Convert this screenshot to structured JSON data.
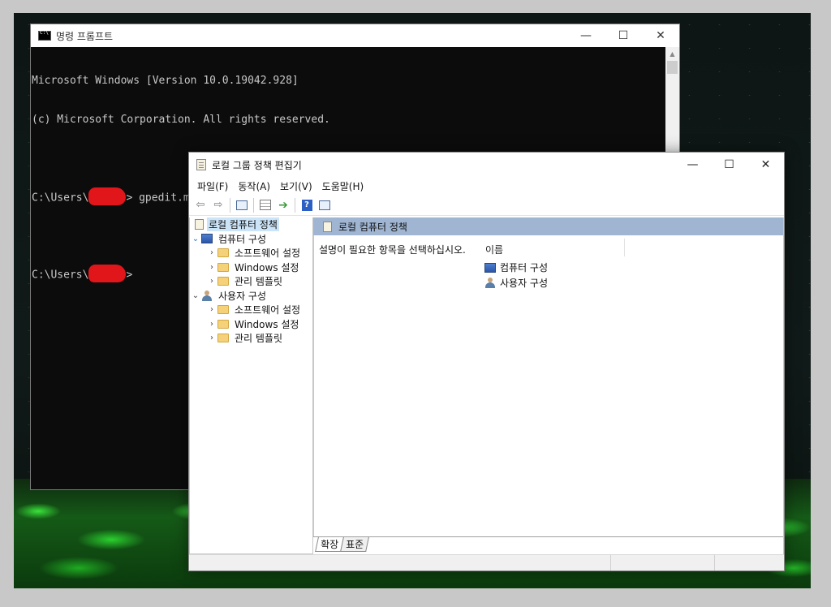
{
  "cmd": {
    "title": "명령 프롬프트",
    "lines": [
      "Microsoft Windows [Version 10.0.19042.928]",
      "(c) Microsoft Corporation. All rights reserved."
    ],
    "prompt_prefix": "C:\\Users\\",
    "prompt_suffix": ">",
    "command": " gpedit.msc"
  },
  "window_controls": {
    "minimize": "—",
    "maximize": "☐",
    "close": "✕"
  },
  "gpedit": {
    "title": "로컬 그룹 정책 편집기",
    "menu": [
      "파일(F)",
      "동작(A)",
      "보기(V)",
      "도움말(H)"
    ],
    "tree": {
      "root": "로컬 컴퓨터 정책",
      "computer": "컴퓨터 구성",
      "computer_children": [
        "소프트웨어 설정",
        "Windows 설정",
        "관리 템플릿"
      ],
      "user": "사용자 구성",
      "user_children": [
        "소프트웨어 설정",
        "Windows 설정",
        "관리 템플릿"
      ]
    },
    "right": {
      "header": "로컬 컴퓨터 정책",
      "description": "설명이 필요한 항목을 선택하십시오.",
      "column_name": "이름",
      "items": [
        "컴퓨터 구성",
        "사용자 구성"
      ]
    },
    "tabs": [
      "확장",
      "표준"
    ]
  }
}
